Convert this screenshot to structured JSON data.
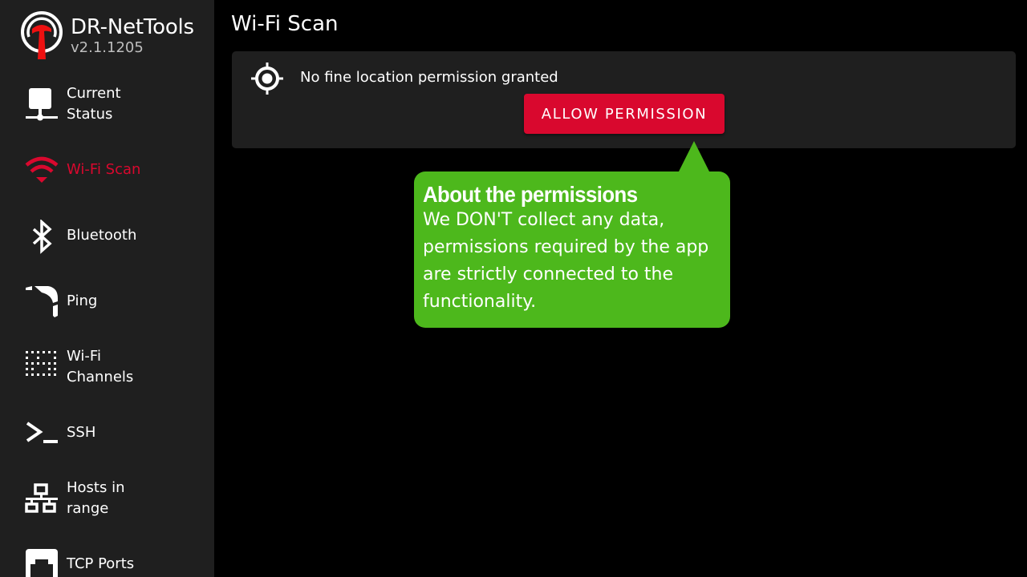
{
  "app": {
    "name": "DR-NetTools",
    "version": "v2.1.1205",
    "logo_icon": "antenna-hammer-logo",
    "accent_color": "#d9082e"
  },
  "sidebar": {
    "items": [
      {
        "label": "Current\nStatus",
        "icon": "network-computer-icon",
        "active": false
      },
      {
        "label": "Wi-Fi Scan",
        "icon": "wifi-icon",
        "active": true
      },
      {
        "label": "Bluetooth",
        "icon": "bluetooth-icon",
        "active": false
      },
      {
        "label": "Ping",
        "icon": "ping-boomerang-icon",
        "active": false
      },
      {
        "label": "Wi-Fi\nChannels",
        "icon": "channels-grid-icon",
        "active": false
      },
      {
        "label": "SSH",
        "icon": "terminal-icon",
        "active": false
      },
      {
        "label": "Hosts in\nrange",
        "icon": "lan-hosts-icon",
        "active": false
      },
      {
        "label": "TCP Ports",
        "icon": "ethernet-port-icon",
        "active": false
      }
    ]
  },
  "main": {
    "title": "Wi-Fi Scan",
    "permission_card": {
      "icon": "gps-location-icon",
      "message": "No fine location permission granted",
      "button_label": "ALLOW PERMISSION",
      "button_color": "#d9082e"
    },
    "tooltip": {
      "title": "About the permissions",
      "body": "We DON'T collect any data,\npermissions required by the app\nare strictly connected to the\nfunctionality.",
      "color": "#4db81c"
    }
  }
}
